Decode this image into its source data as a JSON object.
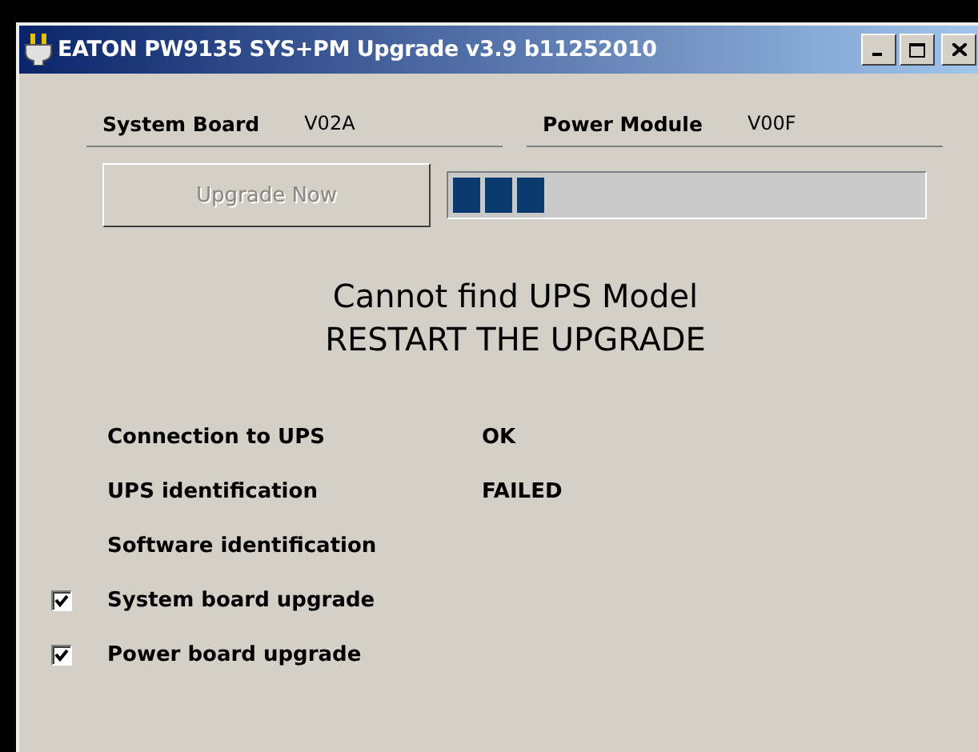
{
  "window": {
    "title": "EATON PW9135 SYS+PM Upgrade v3.9 b11252010"
  },
  "versions": [
    {
      "label": "System Board",
      "value": "V02A"
    },
    {
      "label": "Power Module",
      "value": "V00F"
    }
  ],
  "upgrade_button": {
    "label": "Upgrade Now",
    "disabled": true
  },
  "progress": {
    "level": 0.2
  },
  "message": [
    "Cannot find UPS Model",
    "RESTART THE UPGRADE"
  ],
  "steps": [
    {
      "kind": "status",
      "label": "Connection to UPS",
      "value": "OK"
    },
    {
      "kind": "status",
      "label": "UPS identification",
      "value": "FAILED"
    },
    {
      "kind": "status",
      "label": "Software identification"
    },
    {
      "kind": "checkbox",
      "label": "System board upgrade",
      "checked": true
    },
    {
      "kind": "checkbox",
      "label": "Power board upgrade",
      "checked": true
    }
  ]
}
